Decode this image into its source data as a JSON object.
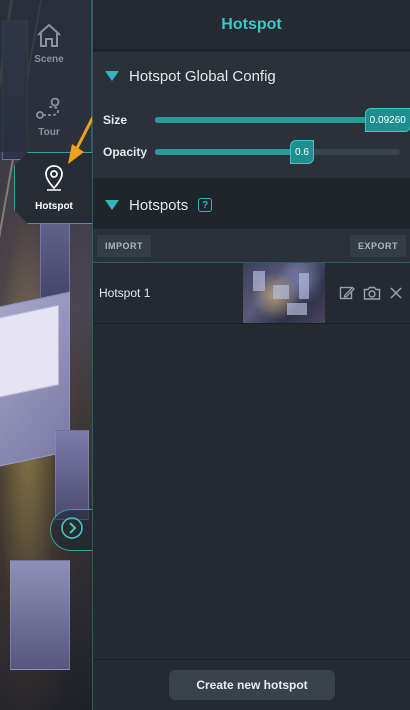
{
  "nav": {
    "items": [
      {
        "label": "Scene",
        "icon": "home-icon"
      },
      {
        "label": "Tour",
        "icon": "route-icon"
      },
      {
        "label": "Hotspot",
        "icon": "map-pin-icon"
      }
    ],
    "active": "Hotspot"
  },
  "panel": {
    "title": "Hotspot",
    "global_config": {
      "title": "Hotspot Global Config",
      "size": {
        "label": "Size",
        "value": "0.09260",
        "fraction": 0.95
      },
      "opacity": {
        "label": "Opacity",
        "value": "0.6",
        "fraction": 0.6
      }
    },
    "hotspots": {
      "title": "Hotspots",
      "help": "?",
      "import_label": "IMPORT",
      "export_label": "EXPORT",
      "items": [
        {
          "name": "Hotspot 1"
        }
      ]
    },
    "create_label": "Create new hotspot"
  },
  "colors": {
    "accent": "#35b3b8",
    "title": "#3fc6c6",
    "annotation_arrow": "#f0a21b"
  }
}
